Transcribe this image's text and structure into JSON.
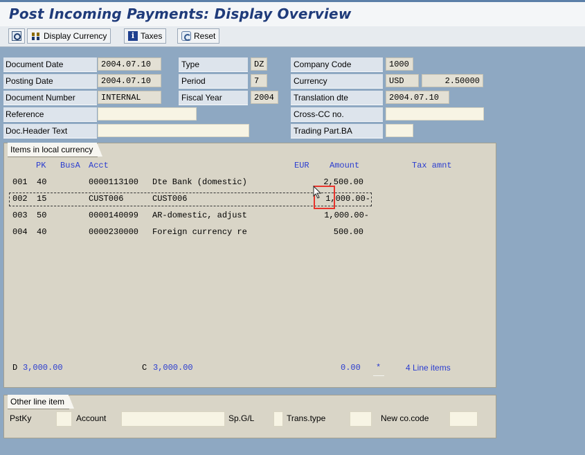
{
  "window": {
    "title": "Post Incoming Payments: Display Overview"
  },
  "toolbar": {
    "display_currency": "Display Currency",
    "taxes": "Taxes",
    "reset": "Reset"
  },
  "header": {
    "document_date_label": "Document Date",
    "document_date": "2004.07.10",
    "posting_date_label": "Posting Date",
    "posting_date": "2004.07.10",
    "document_number_label": "Document Number",
    "document_number": "INTERNAL",
    "reference_label": "Reference",
    "reference": "",
    "doc_header_text_label": "Doc.Header Text",
    "doc_header_text": "",
    "type_label": "Type",
    "type": "DZ",
    "period_label": "Period",
    "period": "7",
    "fiscal_year_label": "Fiscal Year",
    "fiscal_year": "2004",
    "company_code_label": "Company Code",
    "company_code": "1000",
    "currency_label": "Currency",
    "currency": "USD",
    "exchange_rate": "2.50000",
    "translation_date_label": "Translation dte",
    "translation_date": "2004.07.10",
    "cross_cc_label": "Cross-CC no.",
    "cross_cc": "",
    "trading_part_label": "Trading Part.BA",
    "trading_part": ""
  },
  "items": {
    "group_title": "Items in local currency",
    "col_pk": "PK",
    "col_busa": "BusA",
    "col_acct": "Acct",
    "col_currency": "EUR",
    "col_amount": "Amount",
    "col_tax": "Tax amnt",
    "rows": [
      {
        "no": "001",
        "pk": "40",
        "acct": "0000113100",
        "desc": "Dte Bank (domestic)",
        "amount": "2,500.00"
      },
      {
        "no": "002",
        "pk": "15",
        "acct": "CUST006",
        "desc": "CUST006",
        "amount": "1,000.00-"
      },
      {
        "no": "003",
        "pk": "50",
        "acct": "0000140099",
        "desc": "AR-domestic, adjust",
        "amount": "1,000.00-"
      },
      {
        "no": "004",
        "pk": "40",
        "acct": "0000230000",
        "desc": "Foreign currency re",
        "amount": "500.00"
      }
    ],
    "totals": {
      "debit_prefix": "D",
      "debit": "3,000.00",
      "credit_prefix": "C",
      "credit": "3,000.00",
      "balance": "0.00",
      "marker": "*",
      "line_items": "4 Line items"
    }
  },
  "other_line_item": {
    "group_title": "Other line item",
    "pstky_label": "PstKy",
    "account_label": "Account",
    "spgl_label": "Sp.G/L",
    "trans_type_label": "Trans.type",
    "new_co_code_label": "New co.code"
  }
}
